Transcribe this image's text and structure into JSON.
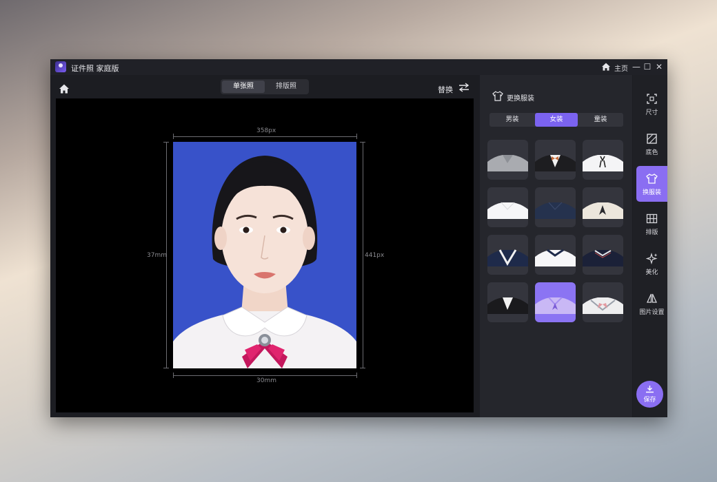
{
  "window": {
    "title": "证件照 家庭版",
    "home_label": "主页",
    "controls": {
      "minimize": "—",
      "maximize": "☐",
      "close": "✕"
    }
  },
  "toolbar": {
    "view_tabs": [
      {
        "label": "单张照",
        "active": true
      },
      {
        "label": "排版照",
        "active": false
      }
    ],
    "replace_label": "替换"
  },
  "preview": {
    "width_px": "358px",
    "height_px": "441px",
    "height_mm": "37mm",
    "width_mm": "30mm",
    "background_color": "#3852c9"
  },
  "clothing_panel": {
    "title": "更换服装",
    "categories": [
      {
        "label": "男装",
        "active": false
      },
      {
        "label": "女装",
        "active": true
      },
      {
        "label": "童装",
        "active": false
      }
    ],
    "items": [
      {
        "name": "gray-shirt",
        "selected": false
      },
      {
        "name": "black-suit-bowtie",
        "selected": false
      },
      {
        "name": "white-blouse-ribbon",
        "selected": false
      },
      {
        "name": "white-shirt",
        "selected": false
      },
      {
        "name": "navy-shirt",
        "selected": false
      },
      {
        "name": "beige-blouse-tie",
        "selected": false
      },
      {
        "name": "navy-sailor-collar",
        "selected": false
      },
      {
        "name": "white-polo-navy-trim",
        "selected": false
      },
      {
        "name": "navy-polo-striped",
        "selected": false
      },
      {
        "name": "black-blazer",
        "selected": false
      },
      {
        "name": "lavender-blouse",
        "selected": true
      },
      {
        "name": "sailor-uniform-bow",
        "selected": false
      }
    ]
  },
  "sidebar": {
    "items": [
      {
        "label": "尺寸",
        "icon": "crop-icon",
        "active": false
      },
      {
        "label": "底色",
        "icon": "background-color-icon",
        "active": false
      },
      {
        "label": "换服装",
        "icon": "shirt-icon",
        "active": true
      },
      {
        "label": "排版",
        "icon": "grid-layout-icon",
        "active": false
      },
      {
        "label": "美化",
        "icon": "sparkle-icon",
        "active": false
      },
      {
        "label": "图片设置",
        "icon": "image-settings-icon",
        "active": false
      }
    ],
    "save_label": "保存"
  },
  "colors": {
    "accent": "#8a6ef2",
    "panel": "#25262c",
    "canvas": "#000000"
  }
}
